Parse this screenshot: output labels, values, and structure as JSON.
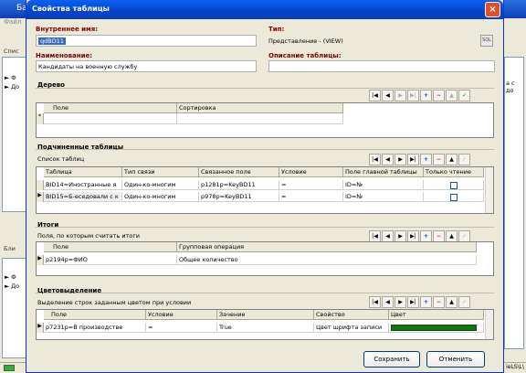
{
  "bg": {
    "title": "Ба",
    "menu": "Файл",
    "tab1": "Спис",
    "side1": "► Ф",
    "side2": "► До",
    "tab2": "Бли",
    "right_text": "а с до",
    "right_text2": "ieLS\\L\\"
  },
  "dialog": {
    "title": "Свойства таблицы",
    "close": "×",
    "internal_name_label": "Внутреннее имя:",
    "internal_name_value": "qdBD11",
    "type_label": "Тип:",
    "type_value": "Представление - (VIEW)",
    "sql_btn": "SQL",
    "name_label": "Наименование:",
    "name_value": "Кандидаты на военную службу",
    "desc_label": "Описание таблицы:",
    "desc_value": "",
    "tree": {
      "title": "Дерево",
      "col1": "Поле",
      "col2": "Сортировка",
      "row_ind": "*"
    },
    "sub": {
      "title": "Подчиненные таблицы",
      "subtitle": "Список таблиц",
      "headers": [
        "Таблица",
        "Тип связи",
        "Связанное поле",
        "Условие",
        "Поле главной таблицы",
        "Только чтение"
      ],
      "rows": [
        {
          "ind": "",
          "c": [
            "BID14=Иностранные я",
            "Один-ко-многим",
            "p1281p=KeyBD11",
            "=",
            "ID=№"
          ]
        },
        {
          "ind": "▶",
          "c": [
            "BID15=Б-еседовали с к",
            "Один-ко-многим",
            "p978p=KeyBD11",
            "=",
            "ID=№"
          ]
        }
      ]
    },
    "totals": {
      "title": "Итоги",
      "subtitle": "Поля, по которым считать итоги",
      "col1": "Поле",
      "col2": "Групповая операция",
      "row": {
        "ind": "▶",
        "field": "p2194p=ФИО",
        "op": "Общее количество"
      }
    },
    "color": {
      "title": "Цветовыделение",
      "subtitle": "Выделение строк заданным цветом при условии",
      "headers": [
        "Поле",
        "Условие",
        "Зачение",
        "Свойство",
        "Цвет"
      ],
      "row": {
        "ind": "▶",
        "c": [
          "p7231p=В производстве",
          "=",
          "True",
          "Цвет шрифта записи"
        ]
      },
      "swatch": "#008000"
    },
    "save": "Сохранить",
    "cancel": "Отменить"
  },
  "nav_icons": [
    "first",
    "prev",
    "next",
    "last",
    "add",
    "delete",
    "up",
    "apply"
  ]
}
